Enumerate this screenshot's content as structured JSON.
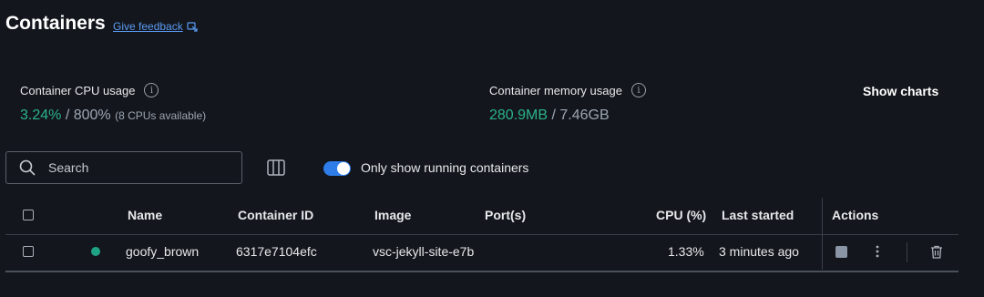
{
  "header": {
    "title": "Containers",
    "feedback_label": "Give feedback"
  },
  "stats": {
    "cpu": {
      "label": "Container CPU usage",
      "used": "3.24%",
      "separator": " / ",
      "total": "800%",
      "note": "(8 CPUs available)"
    },
    "memory": {
      "label": "Container memory usage",
      "used": "280.9MB",
      "separator": " / ",
      "total": "7.46GB"
    },
    "show_charts_label": "Show charts"
  },
  "toolbar": {
    "search_placeholder": "Search",
    "only_running_label": "Only show running containers",
    "only_running_enabled": true
  },
  "table": {
    "columns": {
      "name": "Name",
      "container_id": "Container ID",
      "image": "Image",
      "ports": "Port(s)",
      "cpu": "CPU (%)",
      "last_started": "Last started",
      "actions": "Actions"
    },
    "rows": [
      {
        "status": "running",
        "name": "goofy_brown",
        "container_id": "6317e7104efc",
        "image": "vsc-jekyll-site-e7b",
        "ports": "",
        "cpu": "1.33%",
        "last_started": "3 minutes ago"
      }
    ]
  },
  "colors": {
    "accent": "#2e7de9",
    "link": "#5b9cf5",
    "running": "#1fa387",
    "usage": "#2bb38b",
    "background": "#13161c"
  },
  "icons": [
    "feedback-external-icon",
    "info-icon",
    "search-icon",
    "columns-icon",
    "stop-icon",
    "kebab-menu-icon",
    "trash-icon"
  ]
}
